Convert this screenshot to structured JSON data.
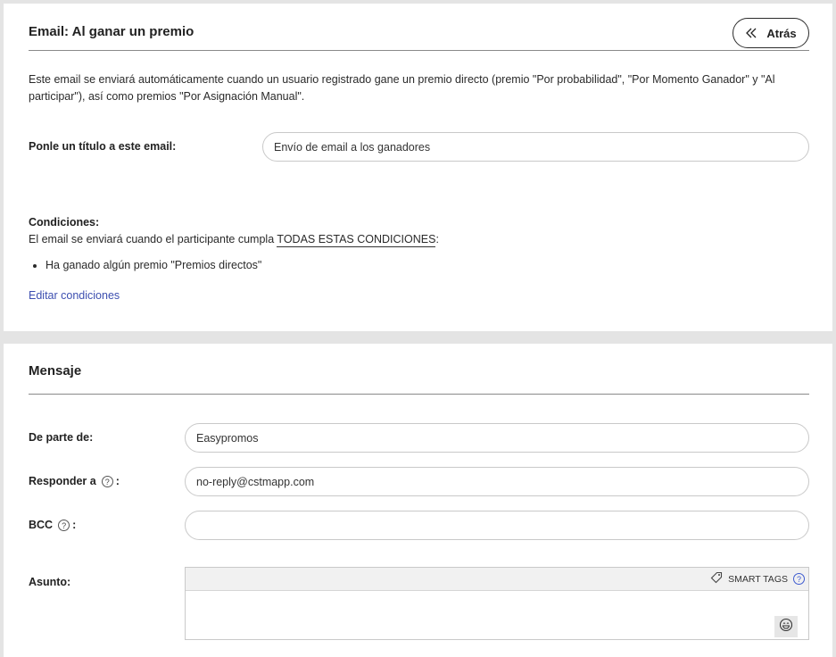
{
  "email_section": {
    "title": "Email: Al ganar un premio",
    "back_label": "Atrás",
    "description": "Este email se enviará automáticamente cuando un usuario registrado gane un premio directo (premio \"Por probabilidad\", \"Por Momento Ganador\" y \"Al participar\"), así como premios \"Por Asignación Manual\".",
    "title_field": {
      "label": "Ponle un título a este email:",
      "value": "Envío de email a los ganadores"
    },
    "conditions": {
      "title": "Condiciones:",
      "text_prefix": "El email se enviará cuando el participante cumpla ",
      "text_emphasis": "TODAS ESTAS CONDICIONES",
      "text_suffix": ":",
      "items": [
        "Ha ganado algún premio \"Premios directos\""
      ],
      "edit_link": "Editar condiciones"
    }
  },
  "message_section": {
    "title": "Mensaje",
    "from": {
      "label": "De parte de:",
      "value": "Easypromos"
    },
    "reply_to": {
      "label": "Responder a",
      "value": "no-reply@cstmapp.com"
    },
    "bcc": {
      "label": "BCC",
      "value": ""
    },
    "subject": {
      "label": "Asunto:",
      "smart_tags_label": "SMART TAGS"
    },
    "help_glyph": "?",
    "colon": ":"
  },
  "icons": {
    "back": "double-chevron-left-icon",
    "help": "question-circle-icon",
    "tag": "tag-icon",
    "emoji": "emoji-icon"
  },
  "colors": {
    "link": "#3d4fb0",
    "help_blue": "#3d5ad0",
    "rule": "#8a8a8a"
  }
}
